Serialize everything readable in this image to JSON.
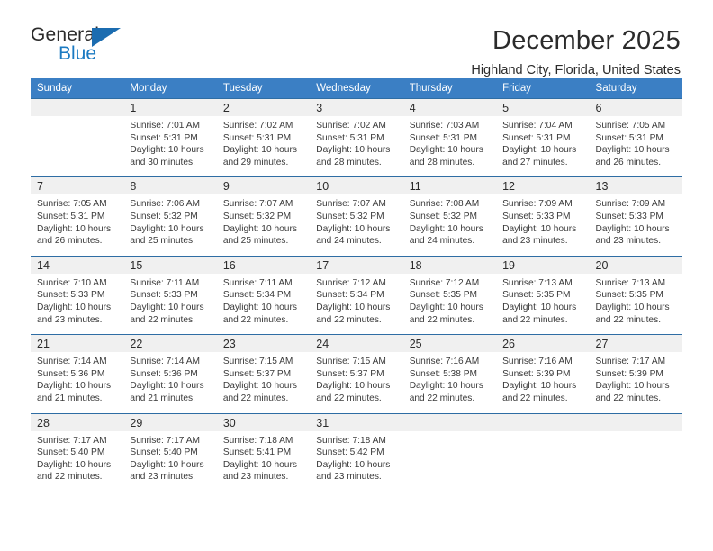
{
  "brand": {
    "name_top": "General",
    "name_bottom": "Blue",
    "triangle_color": "#1b6cb0",
    "text_color": "#2b2b2b",
    "blue_text_color": "#1b7ac2"
  },
  "header": {
    "title": "December 2025",
    "subtitle": "Highland City, Florida, United States"
  },
  "theme": {
    "header_bg": "#3b7fc4",
    "row_border": "#2e6da4",
    "daynum_bg": "#f0f0f0",
    "cell_bg": "#ffffff",
    "text": "#3a3a3a"
  },
  "labels": {
    "sunrise_prefix": "Sunrise:",
    "sunset_prefix": "Sunset:",
    "daylight_prefix": "Daylight:"
  },
  "weekday_headers": [
    "Sunday",
    "Monday",
    "Tuesday",
    "Wednesday",
    "Thursday",
    "Friday",
    "Saturday"
  ],
  "weeks": [
    [
      {
        "day": "",
        "sunrise": "",
        "sunset": "",
        "daylight": "",
        "empty": true
      },
      {
        "day": "1",
        "sunrise": "Sunrise: 7:01 AM",
        "sunset": "Sunset: 5:31 PM",
        "daylight": "Daylight: 10 hours and 30 minutes."
      },
      {
        "day": "2",
        "sunrise": "Sunrise: 7:02 AM",
        "sunset": "Sunset: 5:31 PM",
        "daylight": "Daylight: 10 hours and 29 minutes."
      },
      {
        "day": "3",
        "sunrise": "Sunrise: 7:02 AM",
        "sunset": "Sunset: 5:31 PM",
        "daylight": "Daylight: 10 hours and 28 minutes."
      },
      {
        "day": "4",
        "sunrise": "Sunrise: 7:03 AM",
        "sunset": "Sunset: 5:31 PM",
        "daylight": "Daylight: 10 hours and 28 minutes."
      },
      {
        "day": "5",
        "sunrise": "Sunrise: 7:04 AM",
        "sunset": "Sunset: 5:31 PM",
        "daylight": "Daylight: 10 hours and 27 minutes."
      },
      {
        "day": "6",
        "sunrise": "Sunrise: 7:05 AM",
        "sunset": "Sunset: 5:31 PM",
        "daylight": "Daylight: 10 hours and 26 minutes."
      }
    ],
    [
      {
        "day": "7",
        "sunrise": "Sunrise: 7:05 AM",
        "sunset": "Sunset: 5:31 PM",
        "daylight": "Daylight: 10 hours and 26 minutes."
      },
      {
        "day": "8",
        "sunrise": "Sunrise: 7:06 AM",
        "sunset": "Sunset: 5:32 PM",
        "daylight": "Daylight: 10 hours and 25 minutes."
      },
      {
        "day": "9",
        "sunrise": "Sunrise: 7:07 AM",
        "sunset": "Sunset: 5:32 PM",
        "daylight": "Daylight: 10 hours and 25 minutes."
      },
      {
        "day": "10",
        "sunrise": "Sunrise: 7:07 AM",
        "sunset": "Sunset: 5:32 PM",
        "daylight": "Daylight: 10 hours and 24 minutes."
      },
      {
        "day": "11",
        "sunrise": "Sunrise: 7:08 AM",
        "sunset": "Sunset: 5:32 PM",
        "daylight": "Daylight: 10 hours and 24 minutes."
      },
      {
        "day": "12",
        "sunrise": "Sunrise: 7:09 AM",
        "sunset": "Sunset: 5:33 PM",
        "daylight": "Daylight: 10 hours and 23 minutes."
      },
      {
        "day": "13",
        "sunrise": "Sunrise: 7:09 AM",
        "sunset": "Sunset: 5:33 PM",
        "daylight": "Daylight: 10 hours and 23 minutes."
      }
    ],
    [
      {
        "day": "14",
        "sunrise": "Sunrise: 7:10 AM",
        "sunset": "Sunset: 5:33 PM",
        "daylight": "Daylight: 10 hours and 23 minutes."
      },
      {
        "day": "15",
        "sunrise": "Sunrise: 7:11 AM",
        "sunset": "Sunset: 5:33 PM",
        "daylight": "Daylight: 10 hours and 22 minutes."
      },
      {
        "day": "16",
        "sunrise": "Sunrise: 7:11 AM",
        "sunset": "Sunset: 5:34 PM",
        "daylight": "Daylight: 10 hours and 22 minutes."
      },
      {
        "day": "17",
        "sunrise": "Sunrise: 7:12 AM",
        "sunset": "Sunset: 5:34 PM",
        "daylight": "Daylight: 10 hours and 22 minutes."
      },
      {
        "day": "18",
        "sunrise": "Sunrise: 7:12 AM",
        "sunset": "Sunset: 5:35 PM",
        "daylight": "Daylight: 10 hours and 22 minutes."
      },
      {
        "day": "19",
        "sunrise": "Sunrise: 7:13 AM",
        "sunset": "Sunset: 5:35 PM",
        "daylight": "Daylight: 10 hours and 22 minutes."
      },
      {
        "day": "20",
        "sunrise": "Sunrise: 7:13 AM",
        "sunset": "Sunset: 5:35 PM",
        "daylight": "Daylight: 10 hours and 22 minutes."
      }
    ],
    [
      {
        "day": "21",
        "sunrise": "Sunrise: 7:14 AM",
        "sunset": "Sunset: 5:36 PM",
        "daylight": "Daylight: 10 hours and 21 minutes."
      },
      {
        "day": "22",
        "sunrise": "Sunrise: 7:14 AM",
        "sunset": "Sunset: 5:36 PM",
        "daylight": "Daylight: 10 hours and 21 minutes."
      },
      {
        "day": "23",
        "sunrise": "Sunrise: 7:15 AM",
        "sunset": "Sunset: 5:37 PM",
        "daylight": "Daylight: 10 hours and 22 minutes."
      },
      {
        "day": "24",
        "sunrise": "Sunrise: 7:15 AM",
        "sunset": "Sunset: 5:37 PM",
        "daylight": "Daylight: 10 hours and 22 minutes."
      },
      {
        "day": "25",
        "sunrise": "Sunrise: 7:16 AM",
        "sunset": "Sunset: 5:38 PM",
        "daylight": "Daylight: 10 hours and 22 minutes."
      },
      {
        "day": "26",
        "sunrise": "Sunrise: 7:16 AM",
        "sunset": "Sunset: 5:39 PM",
        "daylight": "Daylight: 10 hours and 22 minutes."
      },
      {
        "day": "27",
        "sunrise": "Sunrise: 7:17 AM",
        "sunset": "Sunset: 5:39 PM",
        "daylight": "Daylight: 10 hours and 22 minutes."
      }
    ],
    [
      {
        "day": "28",
        "sunrise": "Sunrise: 7:17 AM",
        "sunset": "Sunset: 5:40 PM",
        "daylight": "Daylight: 10 hours and 22 minutes."
      },
      {
        "day": "29",
        "sunrise": "Sunrise: 7:17 AM",
        "sunset": "Sunset: 5:40 PM",
        "daylight": "Daylight: 10 hours and 23 minutes."
      },
      {
        "day": "30",
        "sunrise": "Sunrise: 7:18 AM",
        "sunset": "Sunset: 5:41 PM",
        "daylight": "Daylight: 10 hours and 23 minutes."
      },
      {
        "day": "31",
        "sunrise": "Sunrise: 7:18 AM",
        "sunset": "Sunset: 5:42 PM",
        "daylight": "Daylight: 10 hours and 23 minutes."
      },
      {
        "day": "",
        "sunrise": "",
        "sunset": "",
        "daylight": "",
        "empty": true
      },
      {
        "day": "",
        "sunrise": "",
        "sunset": "",
        "daylight": "",
        "empty": true
      },
      {
        "day": "",
        "sunrise": "",
        "sunset": "",
        "daylight": "",
        "empty": true
      }
    ]
  ]
}
